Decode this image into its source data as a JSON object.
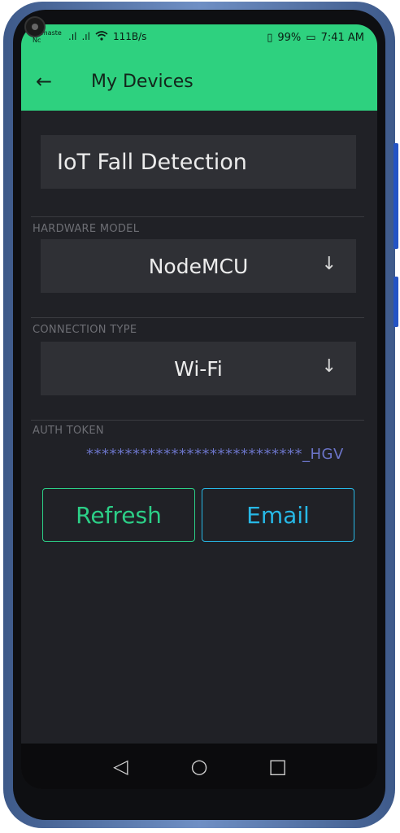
{
  "status_bar": {
    "carrier": "Namaste Nc",
    "signal1": ".ıl",
    "signal2": ".ıl",
    "wifi_icon": "wifi-icon",
    "speed": "111B/s",
    "vibrate": "▯",
    "battery_percent": "99%",
    "battery_icon": "▭",
    "time": "7:41 AM"
  },
  "appbar": {
    "back_icon": "←",
    "title": "My Devices"
  },
  "device_name": "IoT Fall Detection",
  "hardware_model": {
    "label": "HARDWARE MODEL",
    "value": "NodeMCU",
    "arrow": "↓"
  },
  "connection_type": {
    "label": "CONNECTION TYPE",
    "value": "Wi-Fi",
    "arrow": "↓"
  },
  "auth_token": {
    "label": "AUTH TOKEN",
    "value": "****************************_HGV"
  },
  "buttons": {
    "refresh": "Refresh",
    "email": "Email"
  },
  "nav": {
    "back": "◁",
    "home": "○",
    "recents": "□"
  },
  "colors": {
    "accent_green": "#2ed17f",
    "email_blue": "#27b8e6",
    "token_color": "#6b74c8",
    "background": "#202126"
  }
}
